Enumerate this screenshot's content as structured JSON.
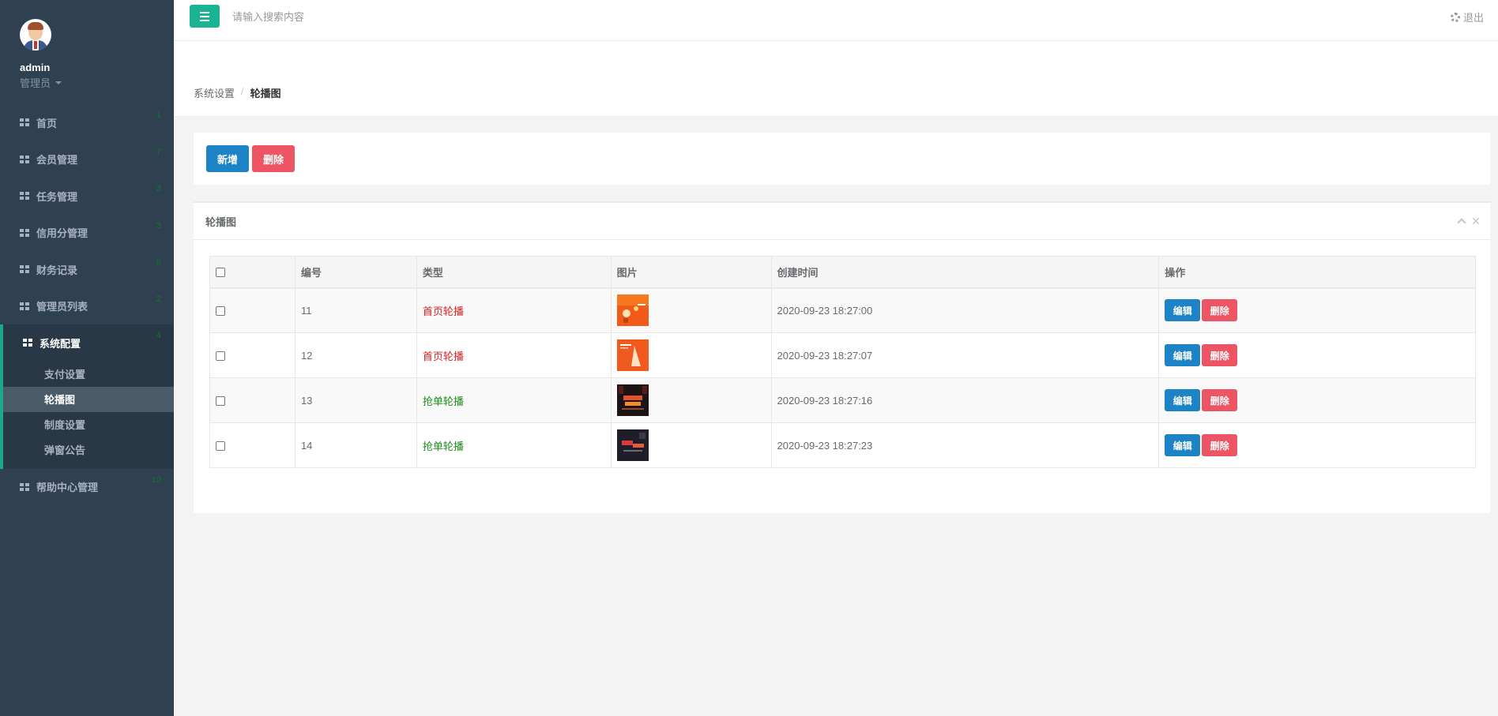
{
  "sidebar": {
    "username": "admin",
    "role": "管理员",
    "items": [
      {
        "label": "首页",
        "badge": "1"
      },
      {
        "label": "会员管理",
        "badge": "7"
      },
      {
        "label": "任务管理",
        "badge": "3"
      },
      {
        "label": "信用分管理",
        "badge": "3"
      },
      {
        "label": "财务记录",
        "badge": "8"
      },
      {
        "label": "管理员列表",
        "badge": "2"
      },
      {
        "label": "系统配置",
        "badge": "4"
      },
      {
        "label": "帮助中心管理",
        "badge": "10"
      }
    ],
    "subitems": [
      "支付设置",
      "轮播图",
      "制度设置",
      "弹窗公告"
    ]
  },
  "topbar": {
    "search_placeholder": "请输入搜索内容",
    "logout": "退出"
  },
  "breadcrumb": {
    "parent": "系统设置",
    "separator": "/",
    "current": "轮播图"
  },
  "actions": {
    "add": "新增",
    "delete": "删除"
  },
  "panel": {
    "title": "轮播图",
    "columns": [
      "编号",
      "类型",
      "图片",
      "创建时间",
      "操作"
    ],
    "rows": [
      {
        "id": "11",
        "type": "首页轮播",
        "created": "2020-09-23 18:27:00",
        "edit": "编辑",
        "del": "删除"
      },
      {
        "id": "12",
        "type": "首页轮播",
        "created": "2020-09-23 18:27:07",
        "edit": "编辑",
        "del": "删除"
      },
      {
        "id": "13",
        "type": "抢单轮播",
        "created": "2020-09-23 18:27:16",
        "edit": "编辑",
        "del": "删除"
      },
      {
        "id": "14",
        "type": "抢单轮播",
        "created": "2020-09-23 18:27:23",
        "edit": "编辑",
        "del": "删除"
      }
    ]
  },
  "colors": {
    "sidebar_bg": "#2f4050",
    "accent_green": "#1ab394",
    "primary_blue": "#1c84c6",
    "danger_red": "#ed5565",
    "type_home": "#e61d1d",
    "type_grab": "#1a8e1a"
  }
}
